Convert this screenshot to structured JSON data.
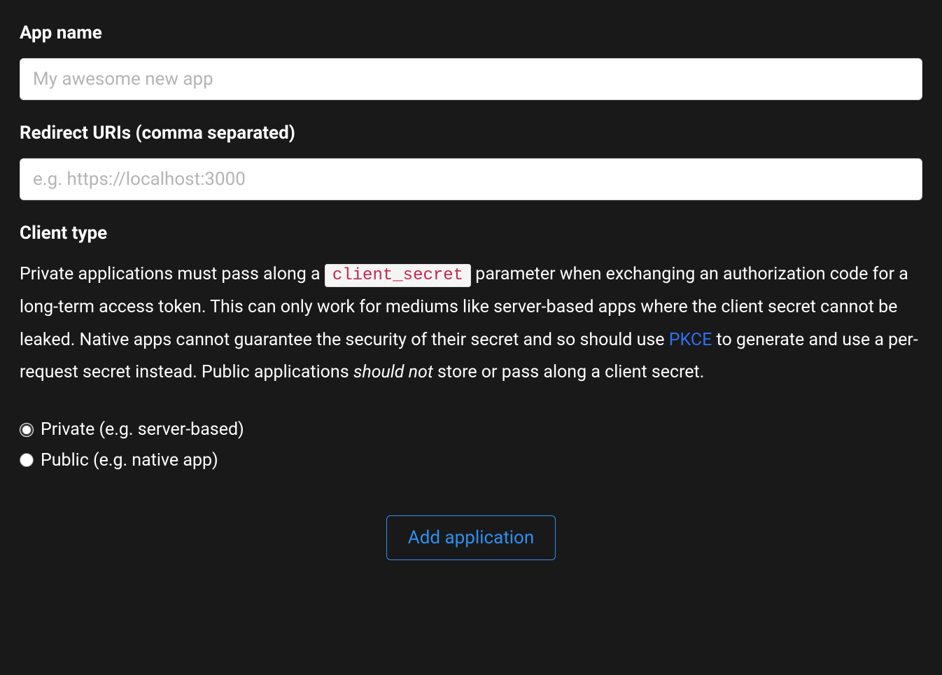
{
  "form": {
    "app_name": {
      "label": "App name",
      "placeholder": "My awesome new app",
      "value": ""
    },
    "redirect_uris": {
      "label": "Redirect URIs (comma separated)",
      "placeholder": "e.g. https://localhost:3000",
      "value": ""
    },
    "client_type": {
      "label": "Client type",
      "description_1": "Private applications must pass along a ",
      "code": "client_secret",
      "description_2": " parameter when exchanging an authorization code for a long-term access token. This can only work for mediums like server-based apps where the client secret cannot be leaked. Native apps cannot guarantee the security of their secret and so should use ",
      "link_text": "PKCE",
      "description_3": " to generate and use a per-request secret instead. Public applications ",
      "emphasis": "should not",
      "description_4": " store or pass along a client secret.",
      "options": {
        "private": "Private (e.g. server-based)",
        "public": "Public (e.g. native app)"
      }
    },
    "submit_label": "Add application"
  }
}
